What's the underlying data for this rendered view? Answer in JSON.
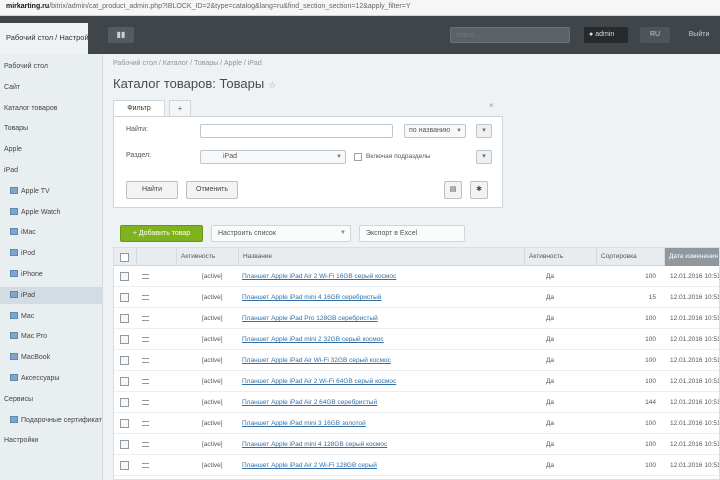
{
  "browser": {
    "url_host": "mirkarting.ru",
    "url_path": "/bitrix/admin/cat_product_admin.php?IBLOCK_ID=2&type=catalog&lang=ru&find_section_section=12&apply_filter=Y"
  },
  "topbar": {
    "active_tab": "Рабочий стол / Настройки",
    "menu_toggle": "▮▮",
    "search_placeholder": "поиск...",
    "user": "admin",
    "lang": "RU",
    "help": "Выйти"
  },
  "sidebar": {
    "items": [
      {
        "label": "Рабочий стол",
        "icon": false
      },
      {
        "label": "Сайт",
        "icon": false
      },
      {
        "label": "Каталог товаров",
        "icon": false
      },
      {
        "label": "Товары",
        "icon": false
      },
      {
        "label": "Apple",
        "icon": false
      },
      {
        "label": "iPad",
        "icon": false
      },
      {
        "label": "Apple TV",
        "icon": true
      },
      {
        "label": "Apple Watch",
        "icon": true
      },
      {
        "label": "iMac",
        "icon": true
      },
      {
        "label": "iPod",
        "icon": true
      },
      {
        "label": "iPhone",
        "icon": true
      },
      {
        "label": "iPad",
        "icon": true,
        "active": true
      },
      {
        "label": "Mac",
        "icon": true
      },
      {
        "label": "Mac Pro",
        "icon": true
      },
      {
        "label": "MacBook",
        "icon": true
      },
      {
        "label": "Аксессуары",
        "icon": true
      },
      {
        "label": "Сервисы",
        "icon": false
      },
      {
        "label": "Подарочные сертификаты",
        "icon": true
      },
      {
        "label": "Настройки",
        "icon": false
      }
    ]
  },
  "breadcrumb": "Рабочий стол / Каталог / Товары / Apple / iPad",
  "page_title": "Каталог товаров: Товары",
  "filter": {
    "tab_label": "Фильтр",
    "add_tab": "+",
    "close": "×",
    "name_label": "Найти:",
    "name_value": "",
    "name_mode": "по названию",
    "section_label": "Раздел:",
    "section_value": "iPad",
    "include_subsections": "Включая подразделы",
    "find_button": "Найти",
    "cancel_button": "Отменить",
    "mini_a": "▾",
    "mini_b": "▾"
  },
  "toolbar": {
    "add_button": "+ Добавить товар",
    "settings_button": "Настроить список",
    "excel_button": "Экспорт в Excel"
  },
  "table": {
    "headers": [
      "",
      "Активность",
      "Название",
      "Активность",
      "Сортировка",
      "Дата изменения"
    ],
    "rows": [
      {
        "status": "[active]",
        "name": "Планшет Apple iPad Air 2 Wi-Fi 16GB серый космос",
        "active": "Да",
        "sort": "100",
        "date": "12.01.2016 10:51:16"
      },
      {
        "status": "[active]",
        "name": "Планшет Apple iPad mini 4 16GB серебристый",
        "active": "Да",
        "sort": "15",
        "date": "12.01.2016 10:51:16"
      },
      {
        "status": "[active]",
        "name": "Планшет Apple iPad Pro 128GB серебристый",
        "active": "Да",
        "sort": "100",
        "date": "12.01.2016 10:51:16"
      },
      {
        "status": "[active]",
        "name": "Планшет Apple iPad mini 2 32GB серый космос",
        "active": "Да",
        "sort": "100",
        "date": "12.01.2016 10:51:16"
      },
      {
        "status": "[active]",
        "name": "Планшет Apple iPad Air Wi-Fi 32GB серый космос",
        "active": "Да",
        "sort": "100",
        "date": "12.01.2016 10:51:16"
      },
      {
        "status": "[active]",
        "name": "Планшет Apple iPad Air 2 Wi-Fi 64GB серый космос",
        "active": "Да",
        "sort": "100",
        "date": "12.01.2016 10:51:16"
      },
      {
        "status": "[active]",
        "name": "Планшет Apple iPad Air 2 64GB серебристый",
        "active": "Да",
        "sort": "144",
        "date": "12.01.2016 10:51:16"
      },
      {
        "status": "[active]",
        "name": "Планшет Apple iPad mini 3 16GB золотой",
        "active": "Да",
        "sort": "100",
        "date": "12.01.2016 10:51:16"
      },
      {
        "status": "[active]",
        "name": "Планшет Apple iPad mini 4 128GB серый космос",
        "active": "Да",
        "sort": "100",
        "date": "12.01.2016 10:51:16"
      },
      {
        "status": "[active]",
        "name": "Планшет Apple iPad Air 2 Wi-Fi 128GB серый",
        "active": "Да",
        "sort": "100",
        "date": "12.01.2016 10:51:16"
      }
    ]
  },
  "colors": {
    "topbar": "#3f4549",
    "add_button": "#7fb21c",
    "link": "#2f6fa8",
    "sorted_header": "#8e989e"
  }
}
